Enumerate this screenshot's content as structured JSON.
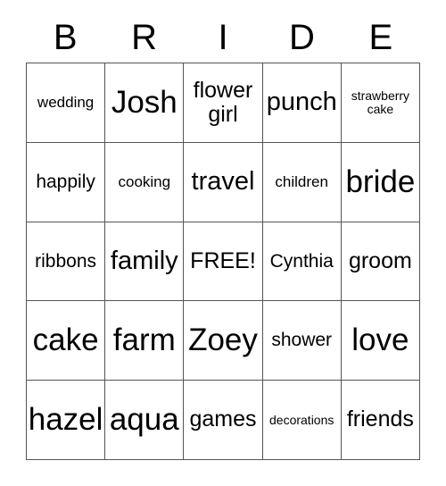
{
  "card": {
    "title_letters": [
      "B",
      "R",
      "I",
      "D",
      "E"
    ],
    "free_space_label": "FREE!",
    "border_color": "#555555",
    "text_color": "#000000",
    "background_color": "#ffffff",
    "columns": 5,
    "rows": 5
  },
  "grid": {
    "rows": [
      {
        "cells": [
          {
            "text": "wedding",
            "size": "s"
          },
          {
            "text": "Josh",
            "size": "xxl"
          },
          {
            "text": "flower girl",
            "size": "l",
            "wrap": true
          },
          {
            "text": "punch",
            "size": "xl"
          },
          {
            "text": "strawberry cake",
            "size": "xs",
            "wrap": true
          }
        ]
      },
      {
        "cells": [
          {
            "text": "happily",
            "size": "m"
          },
          {
            "text": "cooking",
            "size": "s"
          },
          {
            "text": "travel",
            "size": "xl"
          },
          {
            "text": "children",
            "size": "s"
          },
          {
            "text": "bride",
            "size": "xxl"
          }
        ]
      },
      {
        "cells": [
          {
            "text": "ribbons",
            "size": "m"
          },
          {
            "text": "family",
            "size": "xl"
          },
          {
            "text": "FREE!",
            "size": "l"
          },
          {
            "text": "Cynthia",
            "size": "m"
          },
          {
            "text": "groom",
            "size": "l"
          }
        ]
      },
      {
        "cells": [
          {
            "text": "cake",
            "size": "xxl"
          },
          {
            "text": "farm",
            "size": "xxl"
          },
          {
            "text": "Zoey",
            "size": "xxl"
          },
          {
            "text": "shower",
            "size": "m"
          },
          {
            "text": "love",
            "size": "xxl"
          }
        ]
      },
      {
        "cells": [
          {
            "text": "hazel",
            "size": "xxl"
          },
          {
            "text": "aqua",
            "size": "xxl"
          },
          {
            "text": "games",
            "size": "l"
          },
          {
            "text": "decorations",
            "size": "xs"
          },
          {
            "text": "friends",
            "size": "l"
          }
        ]
      }
    ]
  }
}
